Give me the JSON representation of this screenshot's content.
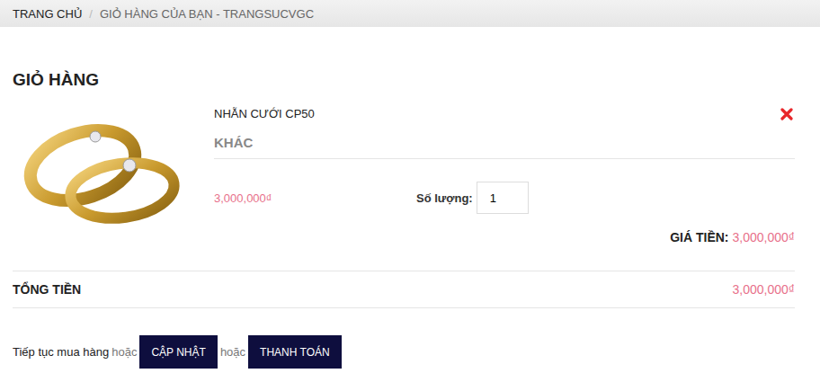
{
  "breadcrumb": [
    {
      "label": "TRANG CHỦ",
      "current": false
    },
    {
      "label": "GIỎ HÀNG CỦA BẠN - TRANGSUCVGC",
      "current": true
    }
  ],
  "separator": "/",
  "title": "GIỎ HÀNG",
  "items": [
    {
      "name": "NHẪN CƯỚI CP50",
      "category": "KHÁC",
      "price": "3,000,000₫",
      "quantity_label": "Số lượng:",
      "quantity": "1",
      "subtotal_label": "GIÁ TIỀN:",
      "subtotal": "3,000,000₫"
    }
  ],
  "total": {
    "label": "TỔNG TIỀN",
    "value": "3,000,000₫"
  },
  "actions": {
    "continue": "Tiếp tục mua hàng",
    "or": "hoặc",
    "buttons": [
      "CẬP NHẬT",
      "THANH TOÁN"
    ]
  }
}
